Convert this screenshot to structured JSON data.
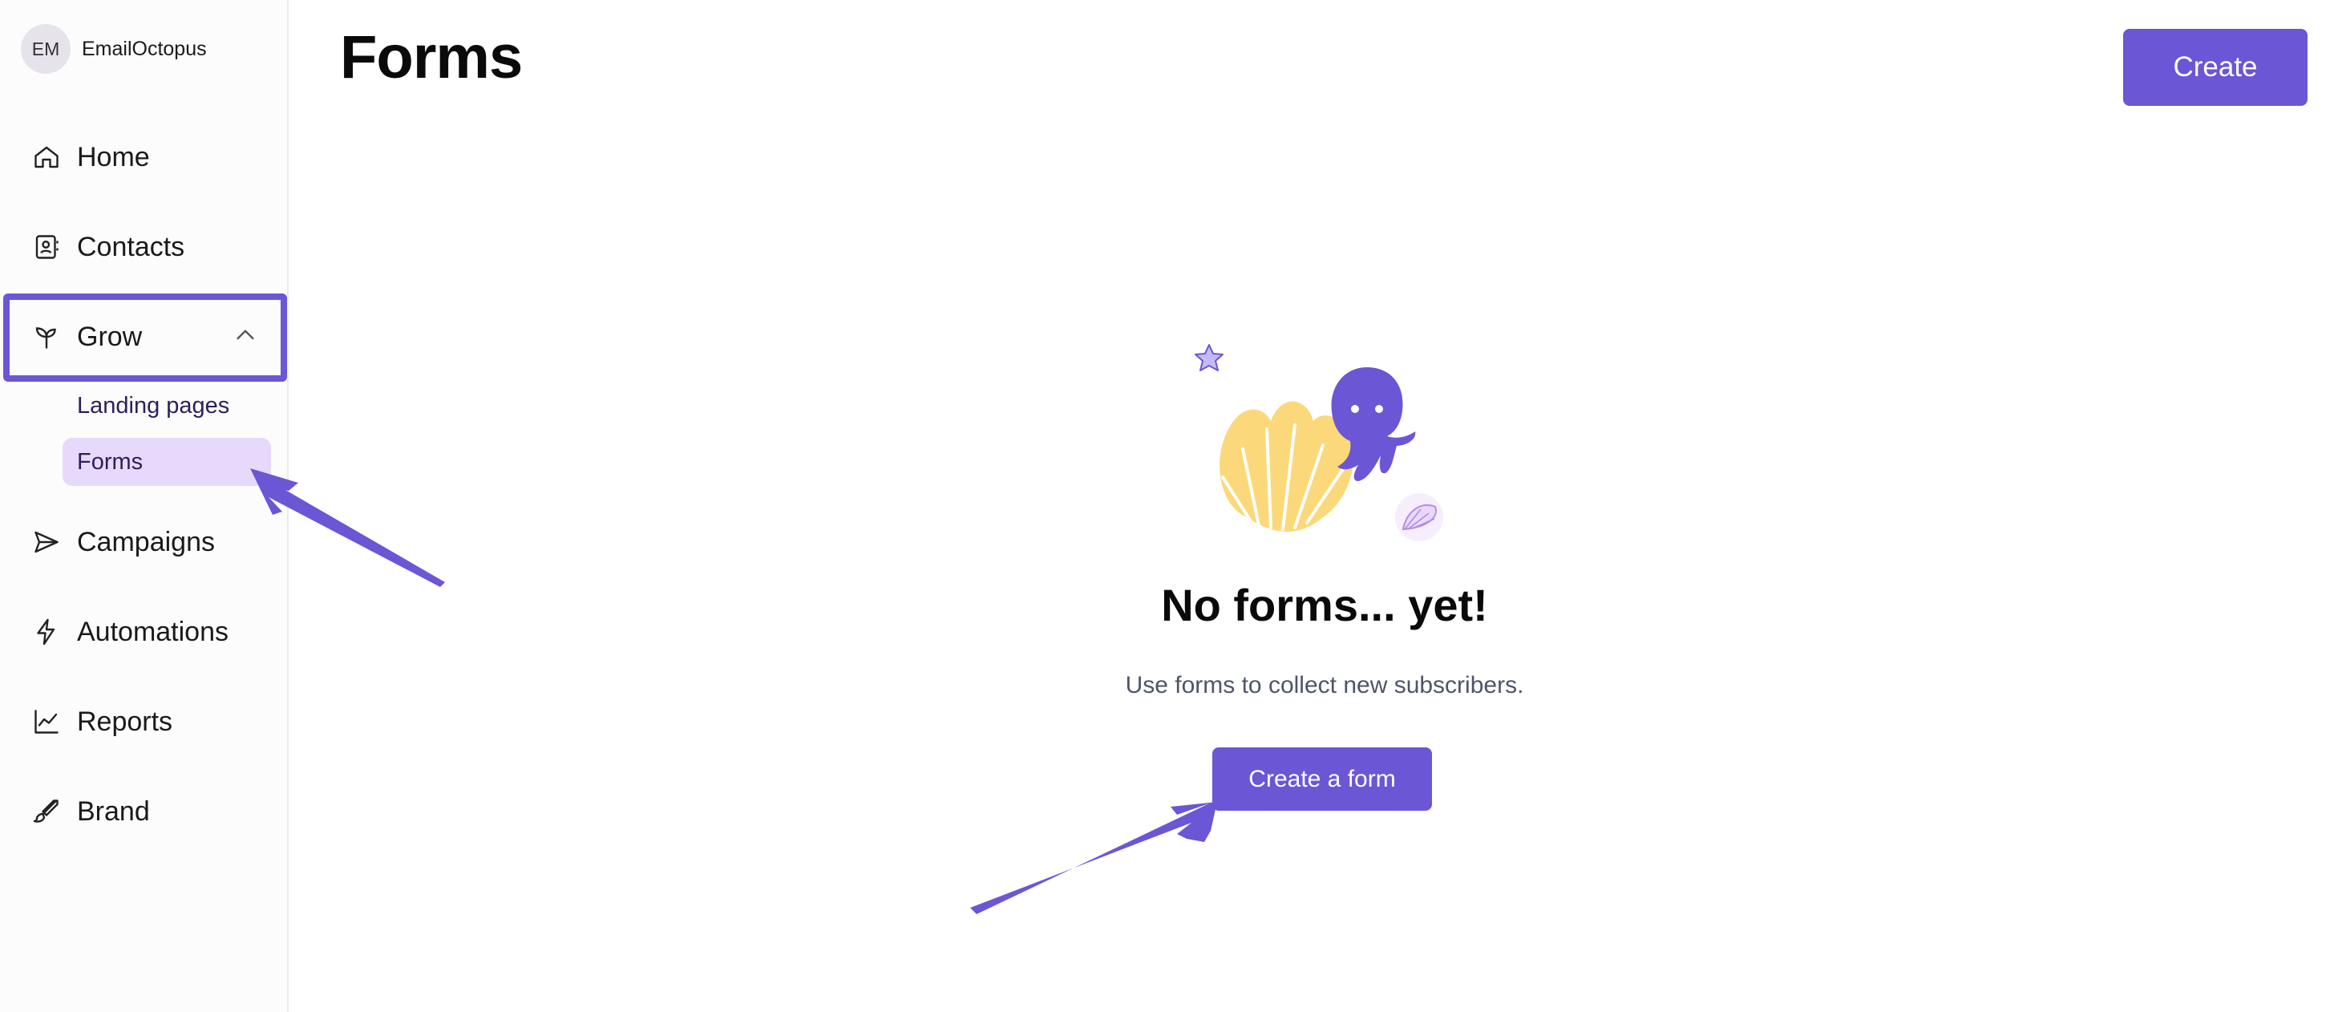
{
  "account": {
    "initials": "EM",
    "name": "EmailOctopus"
  },
  "nav": {
    "home": "Home",
    "contacts": "Contacts",
    "grow": "Grow",
    "grow_children": {
      "landing_pages": "Landing pages",
      "forms": "Forms"
    },
    "campaigns": "Campaigns",
    "automations": "Automations",
    "reports": "Reports",
    "brand": "Brand"
  },
  "header": {
    "title": "Forms",
    "create_label": "Create"
  },
  "empty_state": {
    "title": "No forms... yet!",
    "subtitle": "Use forms to collect new subscribers.",
    "cta_label": "Create a form"
  },
  "colors": {
    "accent": "#6b56d6",
    "active_nav_bg": "#e7d9fb",
    "illustration_yellow": "#fbd97a",
    "octopus": "#6b56d6"
  }
}
